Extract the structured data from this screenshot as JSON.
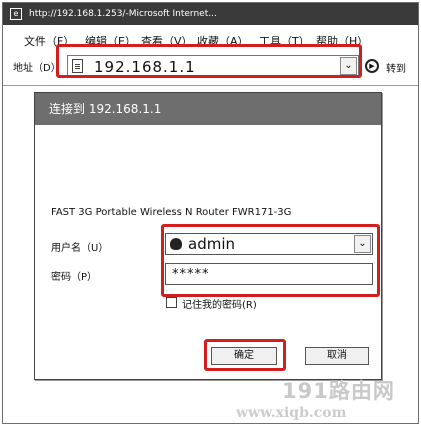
{
  "window": {
    "title": "http://192.168.1.253/-Microsoft  Internet..."
  },
  "menubar": {
    "items": [
      "文件（F）",
      "编辑（E）",
      "查看（V）",
      "收藏（A）",
      "工具（T）",
      "帮助（H）"
    ]
  },
  "address_bar": {
    "label": "地址（D）",
    "url": "192.168.1.1",
    "go_label": "转到"
  },
  "dialog": {
    "title": "连接到 192.168.1.1",
    "message": "FAST 3G Portable Wireless N Router FWR171-3G",
    "username_label": "用户名（U）",
    "username_value": "admin",
    "password_label": "密码（P）",
    "password_value": "*****",
    "remember_label": "记住我的密码(R)",
    "ok_label": "确定",
    "cancel_label": "取消"
  },
  "watermark": {
    "line1": "191路由网",
    "line2": "www.xiqb.com"
  },
  "colors": {
    "highlight": "#d21e1e",
    "titlebar": "#3a3a3a",
    "dialog_titlebar": "#6e6e6e"
  }
}
